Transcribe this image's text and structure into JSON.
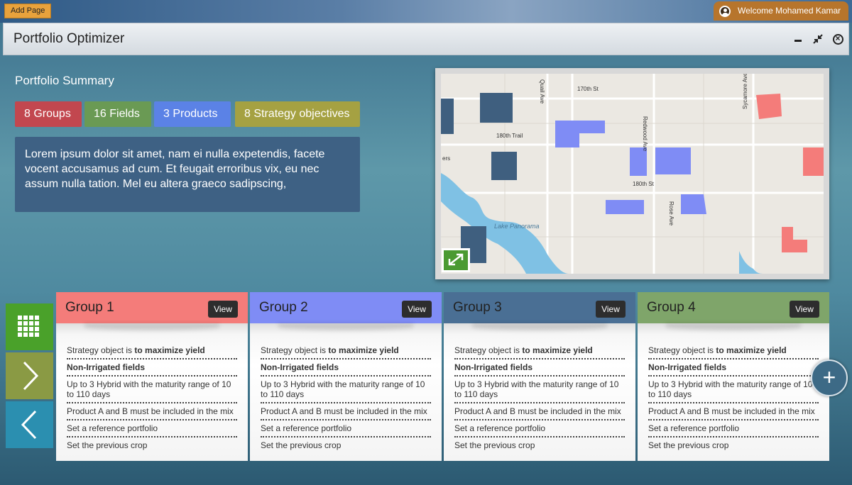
{
  "topbar": {
    "add_page_label": "Add Page",
    "welcome_text": "Welcome Mohamed Kamar"
  },
  "window": {
    "title": "Portfolio Optimizer"
  },
  "summary": {
    "title": "Portfolio Summary",
    "tags": {
      "groups": "8 Groups",
      "fields": "16 Fields",
      "products": "3 Products",
      "strategy": "8 Strategy objectives"
    },
    "description": "Lorem ipsum dolor sit amet, nam ei nulla expetendis, facete vocent accusamus ad cum. Et feugait erroribus vix, eu nec assum nulla tation. Mel eu altera graeco sadipscing,"
  },
  "map": {
    "labels": {
      "quail_ave": "Quail Ave",
      "st170": "170th St",
      "trail180": "180th Trail",
      "redwood_ave": "Redwood Ave",
      "sycamore_ave": "Sycamore Ave",
      "st180": "180th St",
      "rose_ave": "Rose Ave",
      "lake": "Lake Panorama",
      "ers": "ers"
    }
  },
  "groups": [
    {
      "title": "Group 1",
      "color": "#f47c7a",
      "view_label": "View",
      "rules": {
        "strategy_prefix": "Strategy object is ",
        "strategy_value": "to maximize yield",
        "irrigation": "Non-Irrigated fields",
        "hybrid": "Up to 3 Hybrid with the maturity range of 10 to 110 days",
        "products": "Product A and B must be included in the mix",
        "reference": "Set a reference portfolio",
        "crop": "Set the previous crop"
      }
    },
    {
      "title": "Group 2",
      "color": "#7f8cf5",
      "view_label": "View",
      "rules": {
        "strategy_prefix": "Strategy object is ",
        "strategy_value": "to maximize yield",
        "irrigation": "Non-Irrigated fields",
        "hybrid": "Up to 3 Hybrid with the maturity range of 10 to 110 days",
        "products": "Product A and B must be included in the mix",
        "reference": "Set a reference portfolio",
        "crop": "Set the previous crop"
      }
    },
    {
      "title": "Group 3",
      "color": "#4a6f94",
      "view_label": "View",
      "rules": {
        "strategy_prefix": "Strategy object is ",
        "strategy_value": "to maximize yield",
        "irrigation": "Non-Irrigated fields",
        "hybrid": "Up to 3 Hybrid with the maturity range of 10 to 110 days",
        "products": "Product A and B must be included in the mix",
        "reference": "Set a reference portfolio",
        "crop": "Set the previous crop"
      }
    },
    {
      "title": "Group 4",
      "color": "#7fa56a",
      "view_label": "View",
      "rules": {
        "strategy_prefix": "Strategy object is ",
        "strategy_value": "to maximize yield",
        "irrigation": "Non-Irrigated fields",
        "hybrid": "Up to 3 Hybrid with the maturity range of 10 to 110 days",
        "products": "Product A and B must be included in the mix",
        "reference": "Set a reference portfolio",
        "crop": "Set the previous crop"
      }
    }
  ],
  "icons": {
    "grid": "grid-icon",
    "next": "chevron-right-icon",
    "prev": "chevron-left-icon",
    "add": "plus-icon",
    "expand": "expand-icon",
    "user": "user-icon"
  }
}
